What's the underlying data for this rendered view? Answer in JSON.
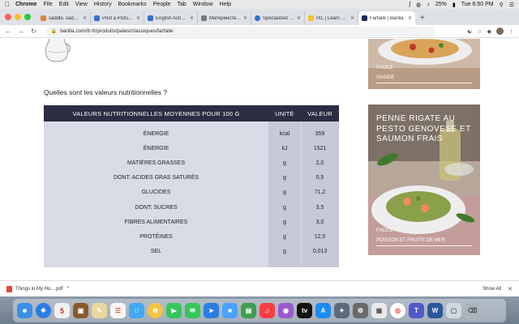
{
  "menubar": {
    "app": "Chrome",
    "items": [
      "File",
      "Edit",
      "View",
      "History",
      "Bookmarks",
      "People",
      "Tab",
      "Window",
      "Help"
    ],
    "battery": "25%",
    "clock": "Tue 6:50 PM"
  },
  "tabs": [
    {
      "label": "saddle, saddle w",
      "color": "#e0863a"
    },
    {
      "label": "Post a Picture of",
      "color": "#3a6fd1"
    },
    {
      "label": "English Activities",
      "color": "#3a6fd1"
    },
    {
      "label": "Материнство «",
      "color": "#7a7a7a"
    },
    {
      "label": "Specialized Sim",
      "color": "#2a6fd6"
    },
    {
      "label": "IXL | Learn grade",
      "color": "#f2c12e"
    },
    {
      "label": "Farfalle | Barilla",
      "color": "#1f2a5a"
    }
  ],
  "toolbar": {
    "url": "barilla.com/fr-fr/produits/pates/classiques/farfalle"
  },
  "page": {
    "question": "Quelles sont les valeurs nutritionnelles ?",
    "table": {
      "headers": [
        "VALEURS NUTRITIONNELLES MOYENNES POUR 100 G",
        "UNITÉ",
        "VALEUR"
      ],
      "rows": [
        {
          "name": "Énergie",
          "unit": "kcal",
          "value": "359"
        },
        {
          "name": "Énergie",
          "unit": "kJ",
          "value": "1521"
        },
        {
          "name": "Matières grasses",
          "unit": "g",
          "value": "2,0"
        },
        {
          "name": "Dont: acides gras saturés",
          "unit": "g",
          "value": "0,5"
        },
        {
          "name": "Glucides",
          "unit": "g",
          "value": "71,2"
        },
        {
          "name": "Dont: sucres",
          "unit": "g",
          "value": "3,5"
        },
        {
          "name": "Fibres alimentaires",
          "unit": "g",
          "value": "3,0"
        },
        {
          "name": "Protéines",
          "unit": "g",
          "value": "12,5"
        },
        {
          "name": "Sel",
          "unit": "g",
          "value": "0,013"
        }
      ]
    },
    "cards": [
      {
        "title": "",
        "level": "FACILE",
        "category": "VIANDE"
      },
      {
        "title": "PENNE RIGATE AU PESTO GENOVESE ET SAUMON FRAIS",
        "level": "FACILE",
        "category": "POISSON ET FRUITS DE MER"
      }
    ]
  },
  "downloads": {
    "file": "Things in My Ho....pdf",
    "show_all": "Show All"
  },
  "dock": {
    "calendar_day": "5"
  }
}
